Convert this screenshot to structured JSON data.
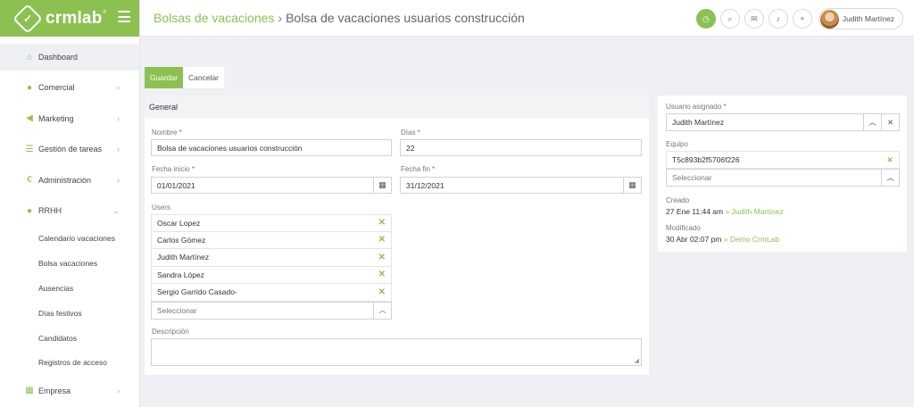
{
  "brand": {
    "name": "crmlab",
    "tm": "®"
  },
  "sidebar": {
    "items": [
      {
        "label": "Dashboard",
        "icon": "home-icon",
        "glyph": "⌂"
      },
      {
        "label": "Comercial",
        "icon": "user-icon",
        "glyph": "●"
      },
      {
        "label": "Marketing",
        "icon": "megaphone-icon",
        "glyph": "◀"
      },
      {
        "label": "Gestión de tareas",
        "icon": "tasks-icon",
        "glyph": "☰"
      },
      {
        "label": "Administración",
        "icon": "euro-icon",
        "glyph": "€"
      },
      {
        "label": "RRHH",
        "icon": "users-icon",
        "glyph": "●"
      }
    ],
    "subitems": [
      "Calendario vacaciones",
      "Bolsa vacaciones",
      "Ausencias",
      "Días festivos",
      "Candidatos",
      "Registros de acceso"
    ],
    "empresa": {
      "label": "Empresa",
      "icon": "building-icon",
      "glyph": "▦"
    }
  },
  "header": {
    "breadcrumb_parent": "Bolsas de vacaciones",
    "separator": "›",
    "breadcrumb_current": "Bolsa de vacaciones usuarios construcción",
    "user_name": "Judith Martínez"
  },
  "toolbar": {
    "save_label": "Guardar",
    "cancel_label": "Cancelar"
  },
  "form": {
    "section_title": "General",
    "nombre_label": "Nombre *",
    "nombre_value": "Bolsa de vacaciones usuarios construcción",
    "dias_label": "Días *",
    "dias_value": "22",
    "fecha_inicio_label": "Fecha inicio *",
    "fecha_inicio_value": "01/01/2021",
    "fecha_fin_label": "Fecha fin *",
    "fecha_fin_value": "31/12/2021",
    "users_label": "Users",
    "users": [
      "Oscar Lopez",
      "Carlos Gómez",
      "Judith Martínez",
      "Sandra López",
      "Sergio Garrido Casado-"
    ],
    "select_placeholder": "Seleccionar",
    "descripcion_label": "Descripción"
  },
  "side": {
    "usuario_label": "Usuario asignado *",
    "usuario_value": "Judith Martínez",
    "equipo_label": "Equipo",
    "equipo_value": "T5c893b2f5706f226",
    "select_placeholder": "Seleccionar",
    "creado_label": "Creado",
    "creado_date": "27 Ene 11:44 am",
    "creado_by": "» Judith Martínez",
    "modificado_label": "Modificado",
    "modificado_date": "30 Abr 02:07 pm",
    "modificado_by": "» Demo CrmLab"
  },
  "colors": {
    "accent": "#8cc152",
    "background": "#eef0f3"
  }
}
